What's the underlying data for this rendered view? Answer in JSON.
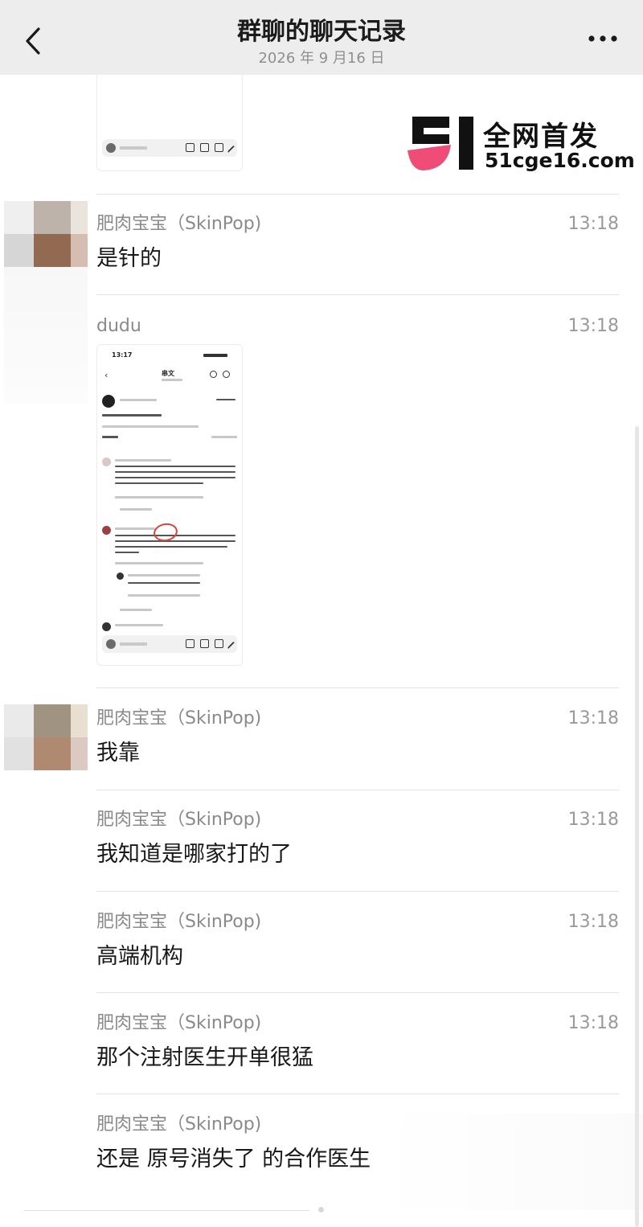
{
  "header": {
    "back_icon": "chevron-left-icon",
    "title": "群聊的聊天记录",
    "date": "2026 年 9 月16 日",
    "more_icon": "more-dots-icon",
    "background": "#ededed"
  },
  "watermark": {
    "line1": "全网首发",
    "line2": "51cge16.com",
    "logo_colors": [
      "#111111",
      "#ef4d78"
    ]
  },
  "thumbnail_inner": {
    "time": "13:17",
    "title": "串文"
  },
  "messages": [
    {
      "sender": "肥肉宝宝（SkinPop)",
      "time": "13:18",
      "text": "是针的",
      "has_avatar": true
    },
    {
      "sender": "dudu",
      "time": "13:18",
      "text": "",
      "attachment": "image",
      "has_avatar": false
    },
    {
      "sender": "肥肉宝宝（SkinPop)",
      "time": "13:18",
      "text": "我靠",
      "has_avatar": true
    },
    {
      "sender": "肥肉宝宝（SkinPop)",
      "time": "13:18",
      "text": "我知道是哪家打的了",
      "has_avatar": false
    },
    {
      "sender": "肥肉宝宝（SkinPop)",
      "time": "13:18",
      "text": "高端机构",
      "has_avatar": false
    },
    {
      "sender": "肥肉宝宝（SkinPop)",
      "time": "13:18",
      "text": "那个注射医生开单很猛",
      "has_avatar": false
    },
    {
      "sender": "肥肉宝宝（SkinPop)",
      "time": "",
      "text": "还是 原号消失了 的合作医生",
      "has_avatar": false
    }
  ]
}
